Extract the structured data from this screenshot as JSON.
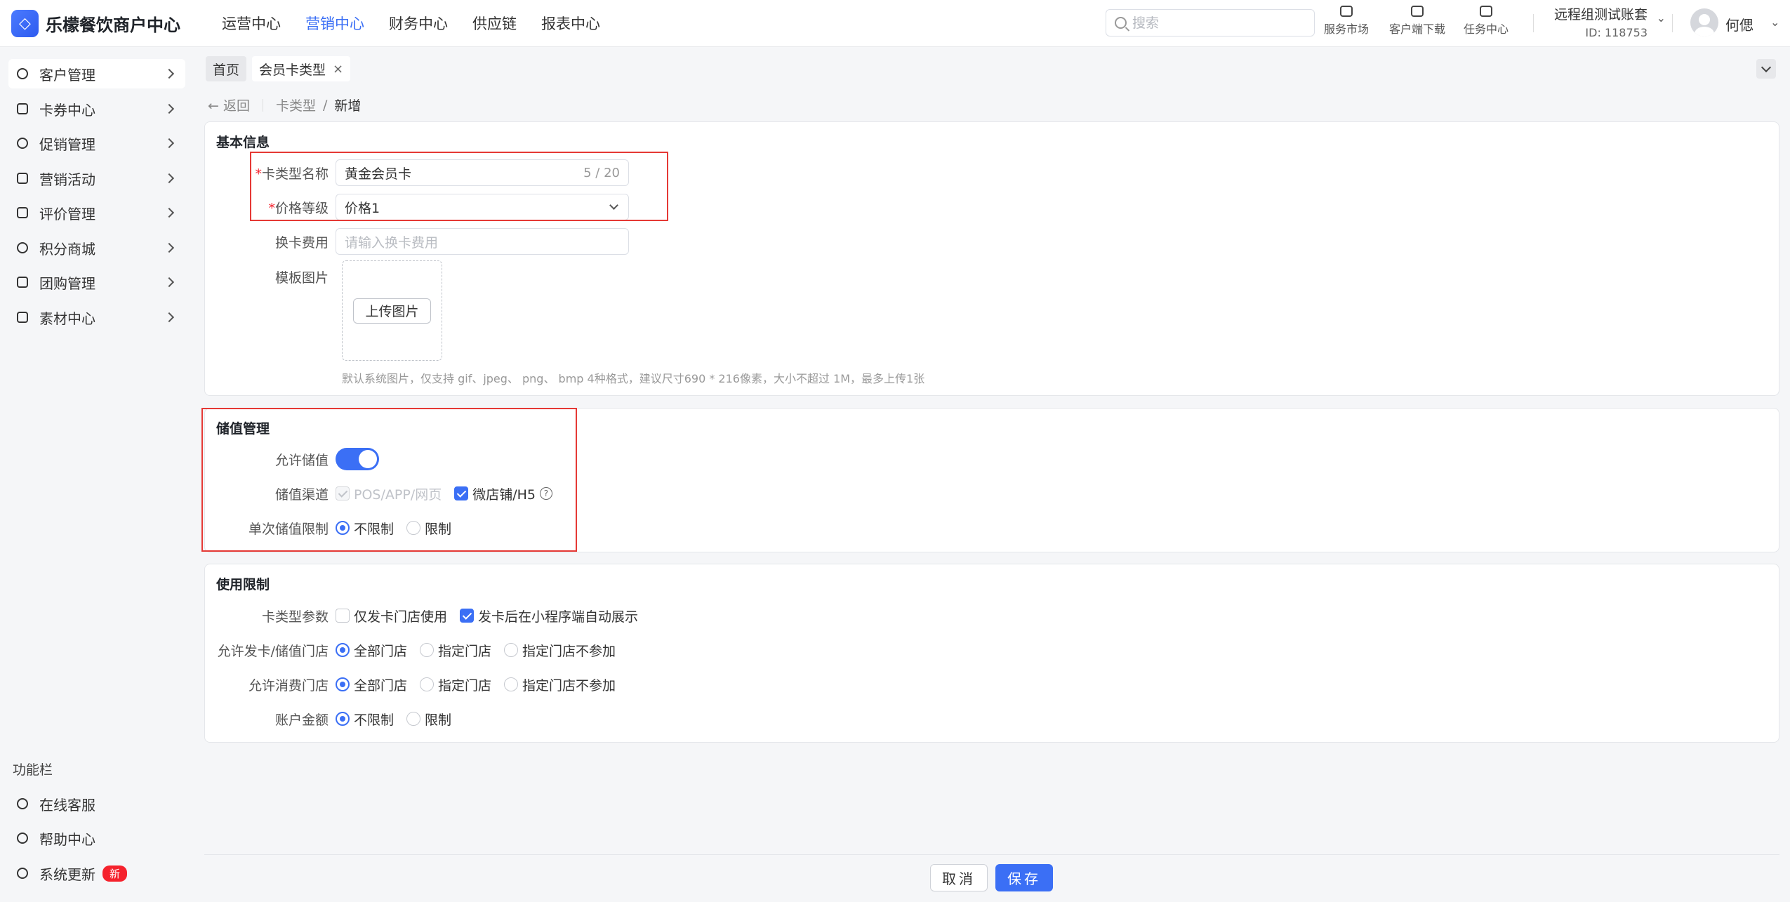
{
  "app": {
    "logo_text": "乐檬餐饮商户中心"
  },
  "topnav": [
    "运营中心",
    "营销中心",
    "财务中心",
    "供应链",
    "报表中心"
  ],
  "search": {
    "placeholder": "搜索"
  },
  "tools": [
    "服务市场",
    "客户端下载",
    "任务中心"
  ],
  "account": {
    "name": "远程组测试账套",
    "id": "ID: 118753"
  },
  "user": {
    "name": "何偲"
  },
  "sidebar": {
    "items": [
      {
        "label": "客户管理"
      },
      {
        "label": "卡券中心"
      },
      {
        "label": "促销管理"
      },
      {
        "label": "营销活动"
      },
      {
        "label": "评价管理"
      },
      {
        "label": "积分商城"
      },
      {
        "label": "团购管理"
      },
      {
        "label": "素材中心"
      }
    ],
    "section_title": "功能栏",
    "footer_items": [
      {
        "label": "在线客服"
      },
      {
        "label": "帮助中心"
      },
      {
        "label": "系统更新",
        "badge": "新"
      }
    ]
  },
  "tabs": [
    {
      "label": "首页"
    },
    {
      "label": "会员卡类型",
      "close": "×"
    }
  ],
  "breadcrumb": {
    "back": "返回",
    "parent": "卡类型",
    "sep": "/",
    "current": "新增"
  },
  "basic": {
    "title": "基本信息",
    "name_label": "卡类型名称",
    "name_value": "黄金会员卡",
    "name_count": "5 / 20",
    "price_label": "价格等级",
    "price_value": "价格1",
    "fee_label": "换卡费用",
    "fee_placeholder": "请输入换卡费用",
    "template_label": "模板图片",
    "upload_label": "上传图片",
    "hint": "默认系统图片，仅支持 gif、jpeg、 png、 bmp 4种格式，建议尺寸690 * 216像素，大小不超过 1M，最多上传1张",
    "required_mark": "*"
  },
  "stored": {
    "title": "储值管理",
    "allow_label": "允许储值",
    "channel_label": "储值渠道",
    "channel_pos": "POS/APP/网页",
    "channel_wx": "微店铺/H5",
    "help": "?",
    "limit_label": "单次储值限制",
    "limit_none": "不限制",
    "limit_on": "限制"
  },
  "usage": {
    "title": "使用限制",
    "param_label": "卡类型参数",
    "param_store_only": "仅发卡门店使用",
    "param_auto_show": "发卡后在小程序端自动展示",
    "issue_label": "允许发卡/储值门店",
    "consume_label": "允许消费门店",
    "all_stores": "全部门店",
    "specified": "指定门店",
    "specified_excluded": "指定门店不参加",
    "amount_label": "账户金额",
    "amount_none": "不限制",
    "amount_on": "限制"
  },
  "footer": {
    "cancel": "取消",
    "save": "保存"
  },
  "colors": {
    "accent": "#3b6ff5",
    "highlight": "#e53935"
  }
}
